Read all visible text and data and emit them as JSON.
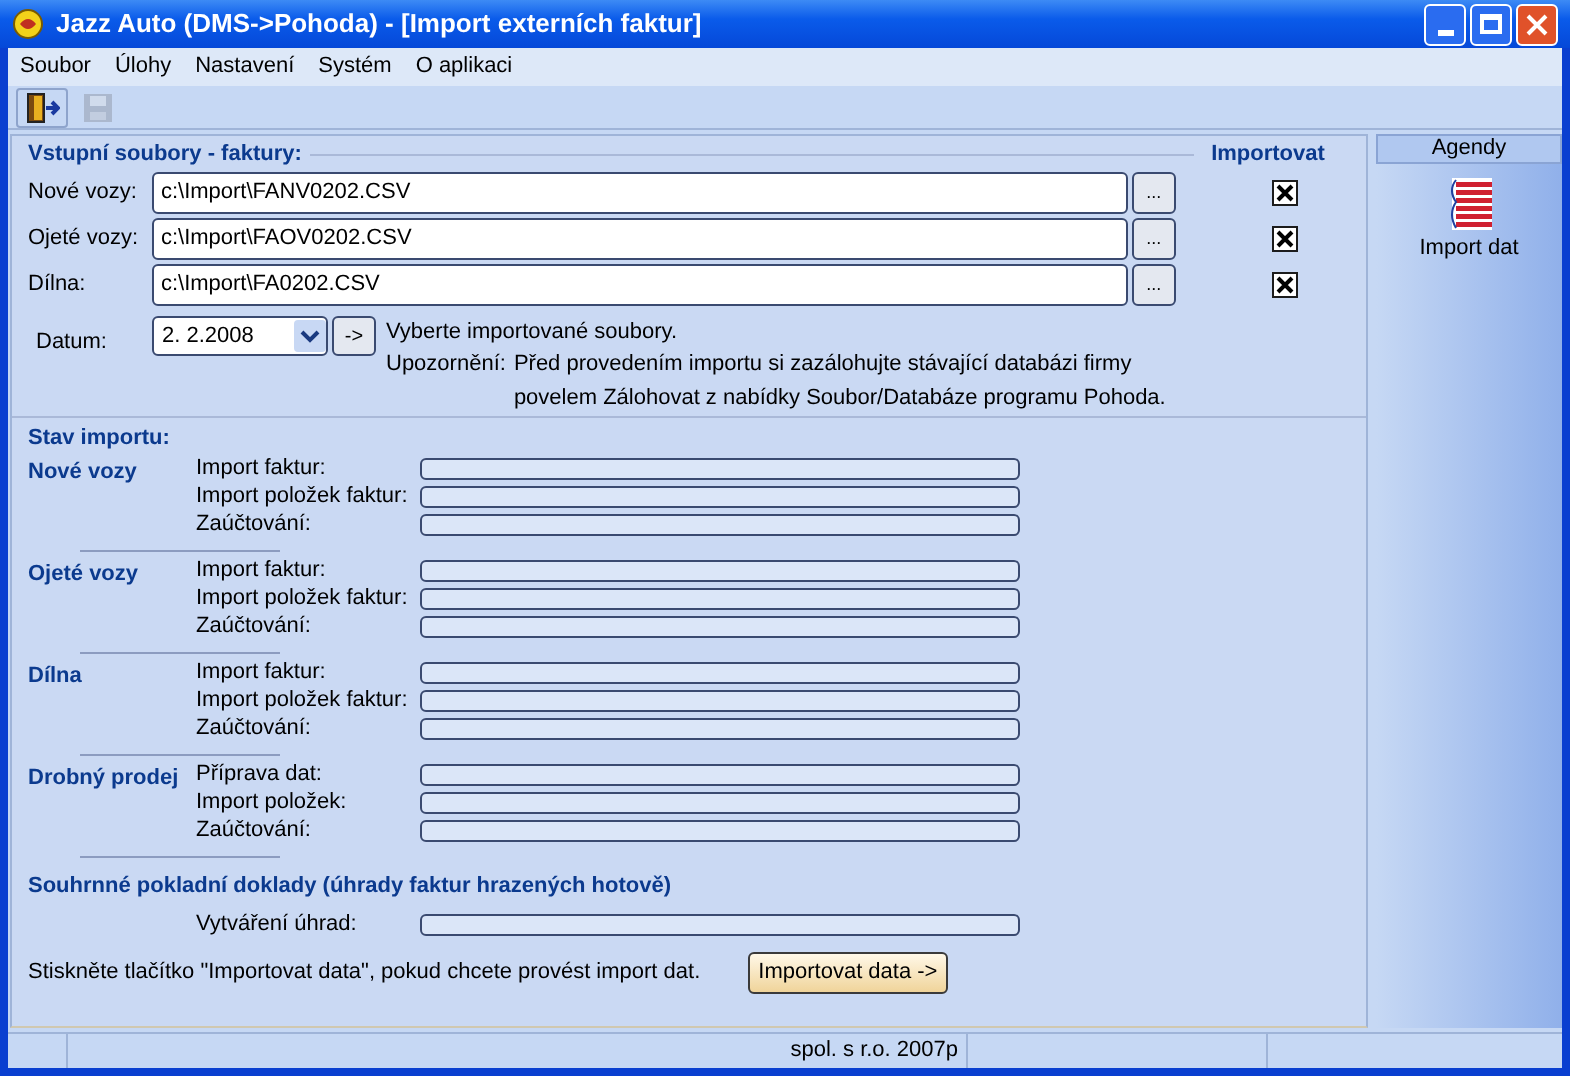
{
  "window": {
    "title": "Jazz Auto (DMS->Pohoda) - [Import externích faktur]"
  },
  "menu": [
    {
      "label": "Soubor"
    },
    {
      "label": "Úlohy"
    },
    {
      "label": "Nastavení"
    },
    {
      "label": "Systém"
    },
    {
      "label": "O aplikaci"
    }
  ],
  "toolbar": [
    {
      "kind": "exit",
      "disabled": false
    },
    {
      "kind": "save",
      "disabled": true
    }
  ],
  "input_files": {
    "title": "Vstupní soubory - faktury:",
    "import_header": "Importovat",
    "rows": [
      {
        "label": "Nové vozy:",
        "value": "c:\\Import\\FANV0202.CSV",
        "browse": "...",
        "checked": true
      },
      {
        "label": "Ojeté vozy:",
        "value": "c:\\Import\\FAOV0202.CSV",
        "browse": "...",
        "checked": true
      },
      {
        "label": "Dílna:",
        "value": "c:\\Import\\FA0202.CSV",
        "browse": "...",
        "checked": true
      }
    ],
    "date_label": "Datum:",
    "date_value": "2. 2.2008",
    "date_button": "->",
    "hint": "Vyberte importované soubory.",
    "warning_label": "Upozornění:",
    "warning": "Před provedením importu si zazálohujte stávající databázi firmy",
    "warning_2": "povelem Zálohovat z nabídky Soubor/Databáze programu Pohoda."
  },
  "status": {
    "title": "Stav importu:",
    "groups": [
      {
        "name": "Nové vozy",
        "steps": [
          {
            "label": "Import faktur:",
            "level": 0
          },
          {
            "label": "Import položek faktur:",
            "level": 0
          },
          {
            "label": "Zaúčtování:",
            "level": 0
          }
        ]
      },
      {
        "name": "Ojeté vozy",
        "steps": [
          {
            "label": "Import faktur:",
            "level": 0
          },
          {
            "label": "Import položek faktur:",
            "level": 0
          },
          {
            "label": "Zaúčtování:",
            "level": 0
          }
        ]
      },
      {
        "name": "Dílna",
        "steps": [
          {
            "label": "Import faktur:",
            "level": 0
          },
          {
            "label": "Import položek faktur:",
            "level": 0
          },
          {
            "label": "Zaúčtování:",
            "level": 0
          }
        ]
      },
      {
        "name": "Drobný prodej",
        "steps": [
          {
            "label": "Příprava dat:",
            "level": 0
          },
          {
            "label": "Import položek:",
            "level": 0
          },
          {
            "label": "Zaúčtování:",
            "level": 0
          }
        ]
      }
    ],
    "summary_title": "Souhrnné pokladní doklady (úhrady faktur hrazených hotově)",
    "summary_step": {
      "label": "Vytváření úhrad:",
      "level": 0
    },
    "instruction": "Stiskněte tlačítko \"Importovat data\", pokud chcete provést import dat.",
    "import_button": "Importovat data ->"
  },
  "sidebar": {
    "title": "Agendy",
    "items": [
      {
        "label": "Import dat"
      }
    ]
  },
  "status_bar": {
    "text": "spol. s r.o. 2007p"
  }
}
